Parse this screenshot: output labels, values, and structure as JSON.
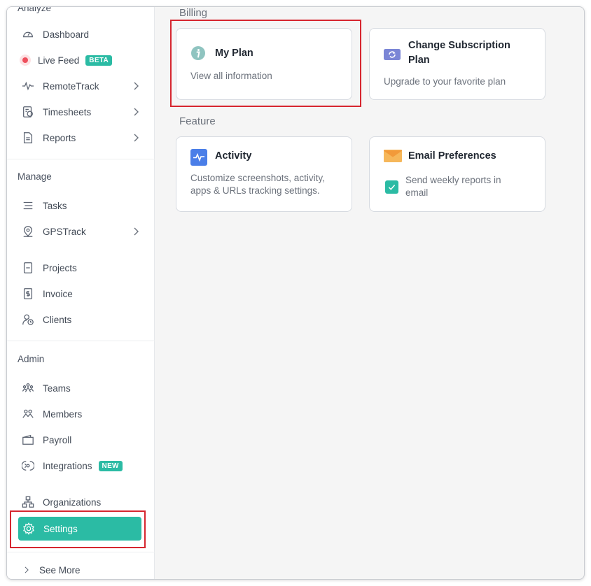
{
  "sidebar": {
    "analyze_title": "Analyze",
    "dashboard": "Dashboard",
    "live_feed": "Live Feed",
    "beta_badge": "BETA",
    "remote_track": "RemoteTrack",
    "timesheets": "Timesheets",
    "reports": "Reports",
    "manage_title": "Manage",
    "tasks": "Tasks",
    "gps_track": "GPSTrack",
    "projects": "Projects",
    "invoice": "Invoice",
    "clients": "Clients",
    "admin_title": "Admin",
    "teams": "Teams",
    "members": "Members",
    "payroll": "Payroll",
    "integrations": "Integrations",
    "new_badge": "NEW",
    "organizations": "Organizations",
    "settings": "Settings",
    "see_more": "See More"
  },
  "main": {
    "billing_title": "Billing",
    "my_plan": {
      "title": "My Plan",
      "desc": "View all information"
    },
    "change_plan": {
      "title_line1": "Change Subscription",
      "title_line2": "Plan",
      "desc": "Upgrade to your favorite plan"
    },
    "feature_title": "Feature",
    "activity": {
      "title": "Activity",
      "desc_line1": "Customize screenshots, activity,",
      "desc_line2": "apps & URLs tracking settings."
    },
    "email_prefs": {
      "title": "Email Preferences",
      "checkbox_line1": "Send weekly reports in",
      "checkbox_line2": "email",
      "checked": true
    }
  },
  "colors": {
    "accent": "#2bbba4",
    "highlight_border": "#d6262f",
    "live_dot": "#ee4f5d"
  },
  "icons": {
    "dashboard": "gauge-icon",
    "remote_track": "pulse-icon",
    "timesheets": "timesheet-icon",
    "reports": "report-icon",
    "tasks": "list-icon",
    "gps_track": "location-pin-icon",
    "projects": "project-file-icon",
    "invoice": "invoice-dollar-icon",
    "clients": "client-clock-icon",
    "teams": "teams-icon",
    "members": "members-icon",
    "payroll": "wallet-icon",
    "integrations": "integrations-icon",
    "organizations": "org-chart-icon",
    "settings": "gear-icon",
    "my_plan": "info-icon",
    "change_plan": "refresh-card-icon",
    "activity": "activity-pulse-icon",
    "email_prefs": "envelope-icon"
  }
}
